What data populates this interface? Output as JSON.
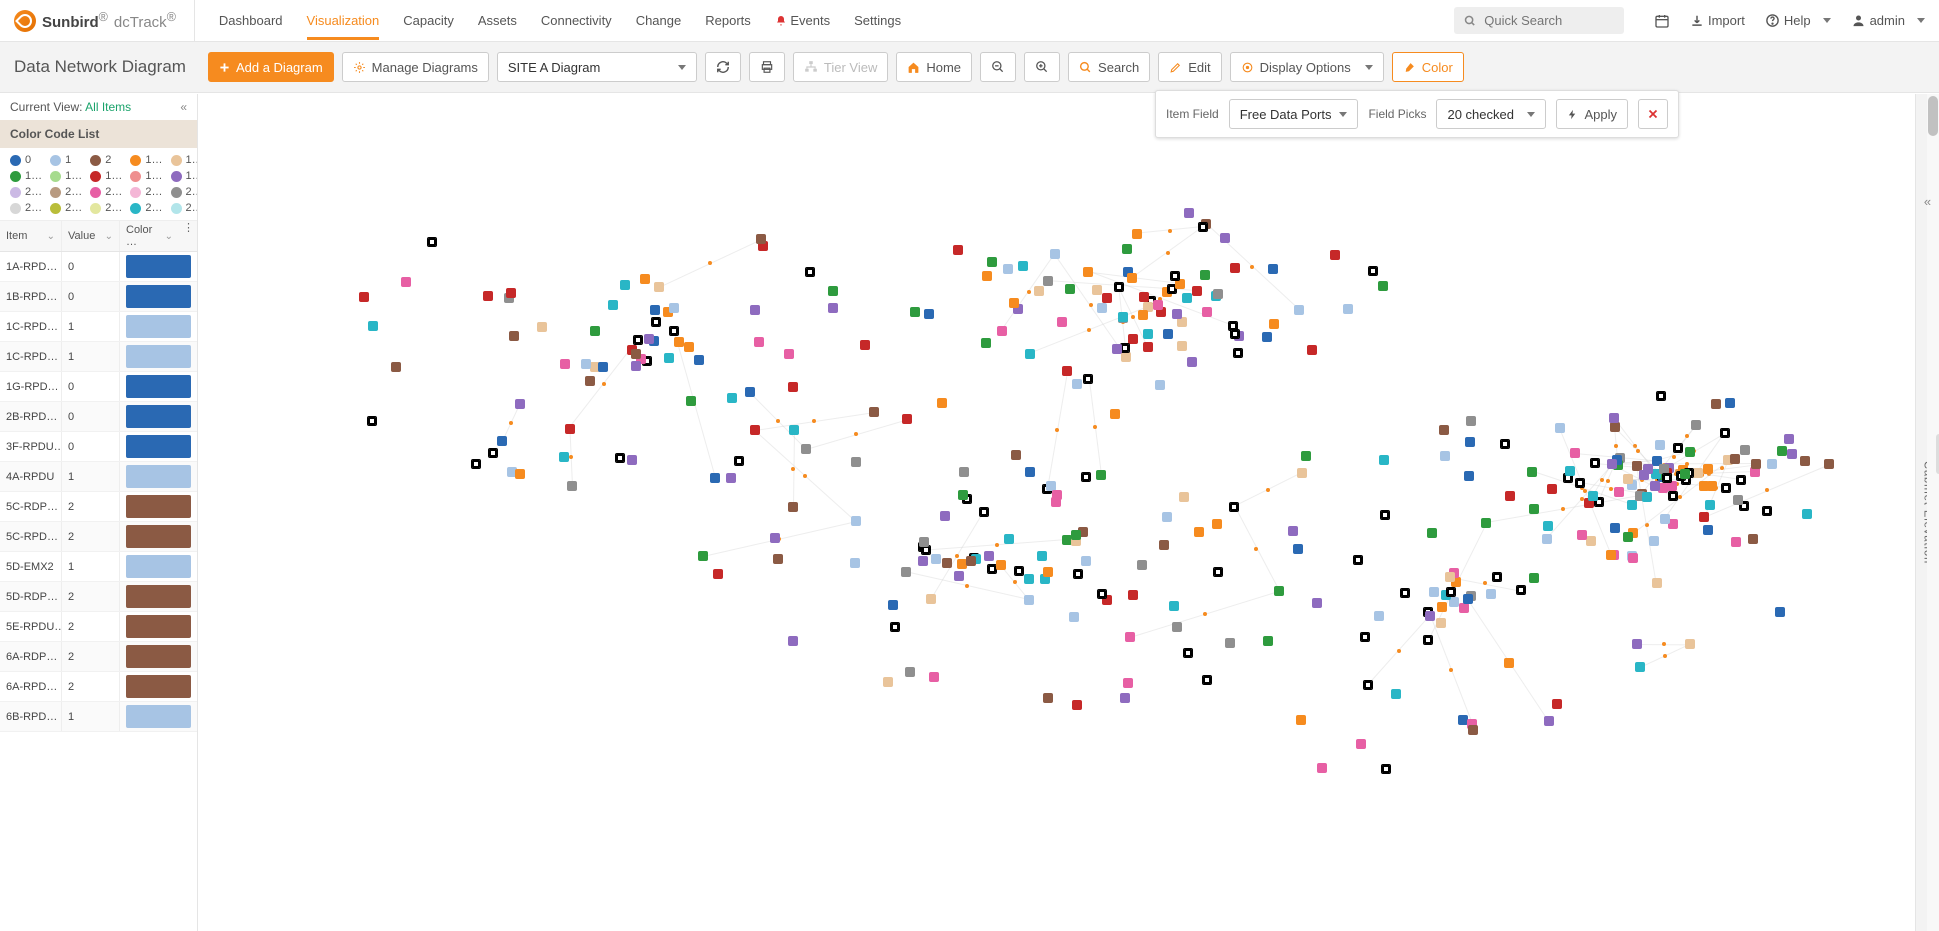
{
  "brand": {
    "name1": "Sunbird",
    "name2": "dcTrack"
  },
  "nav": [
    "Dashboard",
    "Visualization",
    "Capacity",
    "Assets",
    "Connectivity",
    "Change",
    "Reports",
    "Events",
    "Settings"
  ],
  "nav_active": 1,
  "search_placeholder": "Quick Search",
  "top_right": {
    "import": "Import",
    "help": "Help",
    "user": "admin"
  },
  "page_title": "Data Network Diagram",
  "toolbar": {
    "add": "Add a Diagram",
    "manage": "Manage Diagrams",
    "diagram_select": "SITE A Diagram",
    "tier": "Tier View",
    "home": "Home",
    "search": "Search",
    "edit": "Edit",
    "display": "Display Options",
    "color": "Color"
  },
  "filter": {
    "item_field_lbl": "Item Field",
    "item_field_val": "Free Data Ports",
    "field_picks_lbl": "Field Picks",
    "field_picks_val": "20 checked",
    "apply": "Apply"
  },
  "left": {
    "current_view_lbl": "Current View:",
    "current_view_val": "All Items",
    "section_title": "Color Code List",
    "swatches": [
      {
        "c": "#2a69b3",
        "t": "0"
      },
      {
        "c": "#a7c4e4",
        "t": "1"
      },
      {
        "c": "#8b5a44",
        "t": "2"
      },
      {
        "c": "#f68b1f",
        "t": "1…"
      },
      {
        "c": "#e9c49a",
        "t": "1…"
      },
      {
        "c": "#2e9b3e",
        "t": "1…"
      },
      {
        "c": "#a6db8e",
        "t": "1…"
      },
      {
        "c": "#c62828",
        "t": "1…"
      },
      {
        "c": "#ef8f8f",
        "t": "1…"
      },
      {
        "c": "#8e6bbf",
        "t": "1…"
      },
      {
        "c": "#cbb9e4",
        "t": "2…"
      },
      {
        "c": "#b89a80",
        "t": "2…"
      },
      {
        "c": "#e75fa4",
        "t": "2…"
      },
      {
        "c": "#f4b6d6",
        "t": "2…"
      },
      {
        "c": "#8f8f8f",
        "t": "2…"
      },
      {
        "c": "#d7d7d7",
        "t": "2…"
      },
      {
        "c": "#b9bd3a",
        "t": "2…"
      },
      {
        "c": "#e3e79f",
        "t": "2…"
      },
      {
        "c": "#29b6c6",
        "t": "2…"
      },
      {
        "c": "#b2e5ea",
        "t": "2…"
      }
    ],
    "columns": {
      "item": "Item",
      "value": "Value",
      "color": "Color …"
    },
    "rows": [
      {
        "item": "1A-RPD…",
        "value": "0",
        "color": "#2a69b3"
      },
      {
        "item": "1B-RPD…",
        "value": "0",
        "color": "#2a69b3"
      },
      {
        "item": "1C-RPD…",
        "value": "1",
        "color": "#a7c4e4"
      },
      {
        "item": "1C-RPD…",
        "value": "1",
        "color": "#a7c4e4"
      },
      {
        "item": "1G-RPD…",
        "value": "0",
        "color": "#2a69b3"
      },
      {
        "item": "2B-RPD…",
        "value": "0",
        "color": "#2a69b3"
      },
      {
        "item": "3F-RPDU…",
        "value": "0",
        "color": "#2a69b3"
      },
      {
        "item": "4A-RPDU",
        "value": "1",
        "color": "#a7c4e4"
      },
      {
        "item": "5C-RDP…",
        "value": "2",
        "color": "#8b5a44"
      },
      {
        "item": "5C-RPD…",
        "value": "2",
        "color": "#8b5a44"
      },
      {
        "item": "5D-EMX2",
        "value": "1",
        "color": "#a7c4e4"
      },
      {
        "item": "5D-RDP…",
        "value": "2",
        "color": "#8b5a44"
      },
      {
        "item": "5E-RPDU…",
        "value": "2",
        "color": "#8b5a44"
      },
      {
        "item": "6A-RDP…",
        "value": "2",
        "color": "#8b5a44"
      },
      {
        "item": "6A-RPD…",
        "value": "2",
        "color": "#8b5a44"
      },
      {
        "item": "6B-RPD…",
        "value": "1",
        "color": "#a7c4e4"
      }
    ]
  },
  "right_rail": "Cabinet Elevation",
  "node_palette": [
    "#2a69b3",
    "#a7c4e4",
    "#8b5a44",
    "#f68b1f",
    "#e9c49a",
    "#2e9b3e",
    "#c62828",
    "#8e6bbf",
    "#e75fa4",
    "#8f8f8f",
    "#29b6c6",
    "#111"
  ]
}
